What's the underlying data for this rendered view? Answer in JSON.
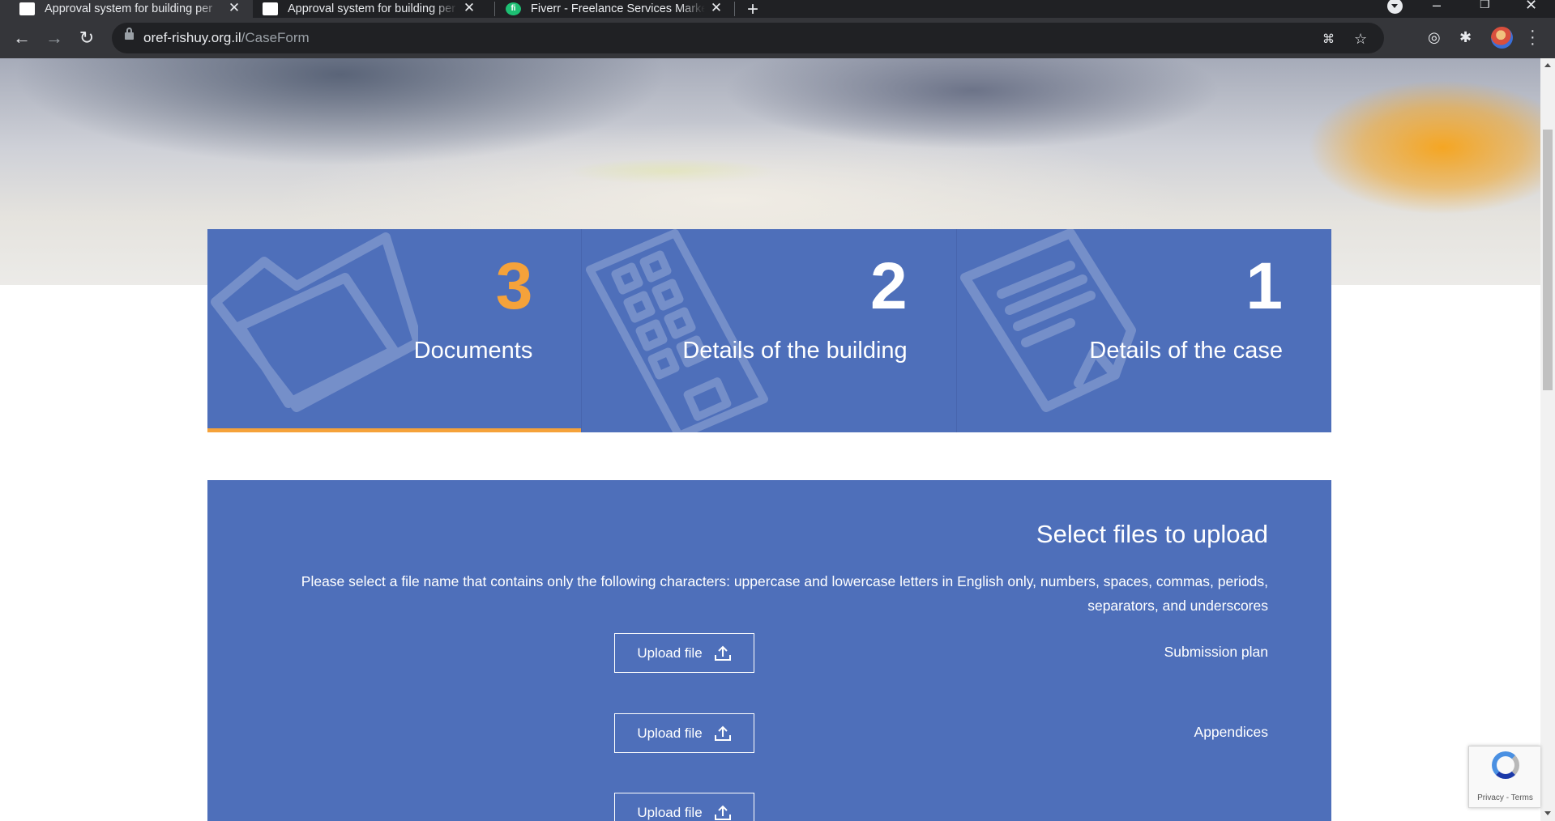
{
  "browser": {
    "tabs": [
      {
        "title": "Approval system for building per",
        "active": true
      },
      {
        "title": "Approval system for building per",
        "active": false
      },
      {
        "title": "Fiverr - Freelance Services Marke",
        "active": false
      }
    ],
    "url_host": "oref-rishuy.org.il",
    "url_path": "/CaseForm"
  },
  "steps": [
    {
      "number": "3",
      "label": "Documents",
      "icon": "folder-icon",
      "active": true
    },
    {
      "number": "2",
      "label": "Details of the building",
      "icon": "building-icon",
      "active": false
    },
    {
      "number": "1",
      "label": "Details of the case",
      "icon": "document-icon",
      "active": false
    }
  ],
  "upload_section": {
    "title": "Select files to upload",
    "description": "Please select a file name that contains only the following characters: uppercase and lowercase letters in English only, numbers, spaces, commas, periods, separators, and underscores",
    "rows": [
      {
        "label": "Submission plan",
        "button": "Upload file"
      },
      {
        "label": "Appendices",
        "button": "Upload file"
      },
      {
        "label": "",
        "button": "Upload file"
      }
    ]
  },
  "recaptcha": {
    "text": "Privacy - Terms"
  },
  "colors": {
    "panel_blue": "#4e6fba",
    "accent_orange": "#f5a23a",
    "chrome_dark": "#202124"
  }
}
